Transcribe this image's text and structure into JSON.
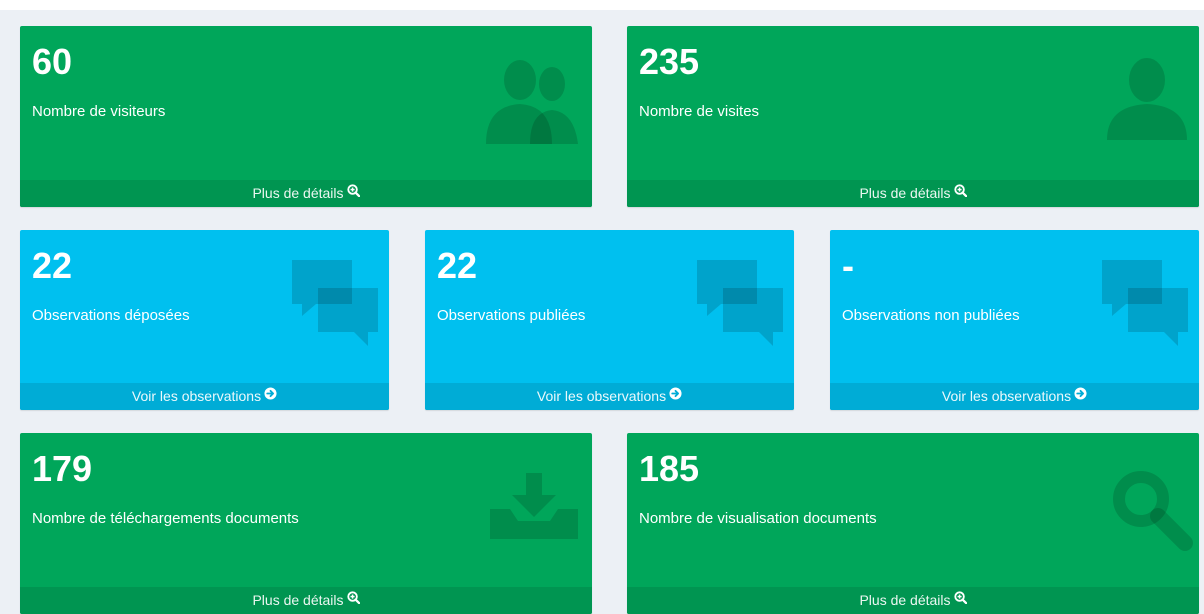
{
  "colors": {
    "green": "#00a65a",
    "green_footer": "#009551",
    "aqua": "#00c0ef",
    "aqua_footer": "#00acd6"
  },
  "boxes": [
    {
      "value": "60",
      "label": "Nombre de visiteurs",
      "footer": "Plus de détails",
      "icon": "users-icon",
      "footer_icon": "search-plus-icon"
    },
    {
      "value": "235",
      "label": "Nombre de visites",
      "footer": "Plus de détails",
      "icon": "user-icon",
      "footer_icon": "search-plus-icon"
    },
    {
      "value": "22",
      "label": "Observations déposées",
      "footer": "Voir les observations",
      "icon": "comments-icon",
      "footer_icon": "arrow-circle-right-icon"
    },
    {
      "value": "22",
      "label": "Observations publiées",
      "footer": "Voir les observations",
      "icon": "comments-icon",
      "footer_icon": "arrow-circle-right-icon"
    },
    {
      "value": "-",
      "label": "Observations non publiées",
      "footer": "Voir les observations",
      "icon": "comments-icon",
      "footer_icon": "arrow-circle-right-icon"
    },
    {
      "value": "179",
      "label": "Nombre de téléchargements documents",
      "footer": "Plus de détails",
      "icon": "download-icon",
      "footer_icon": "search-plus-icon"
    },
    {
      "value": "185",
      "label": "Nombre de visualisation documents",
      "footer": "Plus de détails",
      "icon": "search-icon",
      "footer_icon": "search-plus-icon"
    }
  ]
}
